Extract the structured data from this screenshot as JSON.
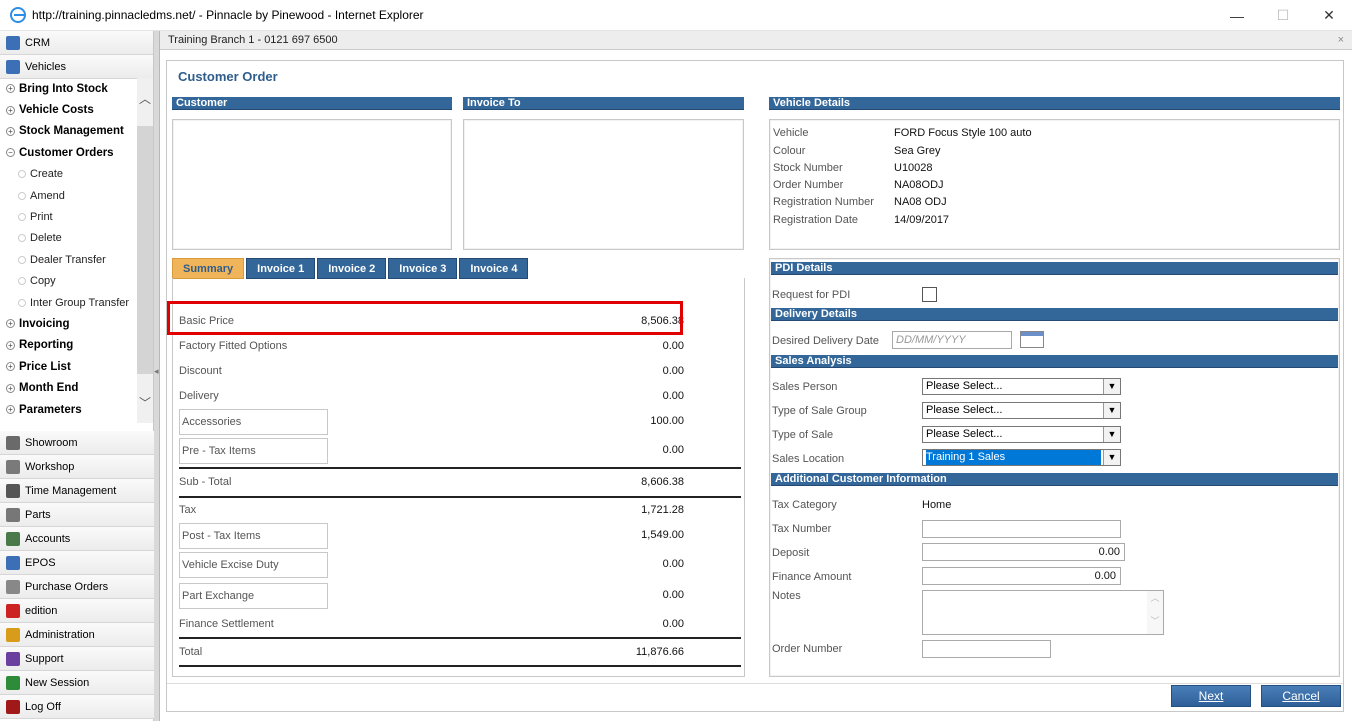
{
  "window": {
    "title": "http://training.pinnacledms.net/ - Pinnacle by Pinewood - Internet Explorer",
    "min": "—",
    "max": "☐",
    "close": "✕"
  },
  "nav": {
    "top": [
      {
        "label": "CRM",
        "icon": "person-icon",
        "color": "#3b6fb6"
      },
      {
        "label": "Vehicles",
        "icon": "car-icon",
        "color": "#3b6fb6"
      }
    ],
    "tree": [
      {
        "label": "Bring Into Stock",
        "type": "group",
        "sign": "+"
      },
      {
        "label": "Vehicle Costs",
        "type": "group",
        "sign": "+"
      },
      {
        "label": "Stock Management",
        "type": "group",
        "sign": "+"
      },
      {
        "label": "Customer Orders",
        "type": "group",
        "sign": "−"
      },
      {
        "label": "Create",
        "type": "sub"
      },
      {
        "label": "Amend",
        "type": "sub"
      },
      {
        "label": "Print",
        "type": "sub"
      },
      {
        "label": "Delete",
        "type": "sub"
      },
      {
        "label": "Dealer Transfer",
        "type": "sub"
      },
      {
        "label": "Copy",
        "type": "sub"
      },
      {
        "label": "Inter Group Transfer",
        "type": "sub"
      },
      {
        "label": "Invoicing",
        "type": "group",
        "sign": "+"
      },
      {
        "label": "Reporting",
        "type": "group",
        "sign": "+"
      },
      {
        "label": "Price List",
        "type": "group",
        "sign": "+"
      },
      {
        "label": "Month End",
        "type": "group",
        "sign": "+"
      },
      {
        "label": "Parameters",
        "type": "group",
        "sign": "+"
      }
    ],
    "bottom": [
      {
        "label": "Showroom",
        "icon": "showroom-icon",
        "color": "#6a6a6a"
      },
      {
        "label": "Workshop",
        "icon": "wrench-icon",
        "color": "#7a7a7a"
      },
      {
        "label": "Time Management",
        "icon": "clock-icon",
        "color": "#555555"
      },
      {
        "label": "Parts",
        "icon": "gear-icon",
        "color": "#777777"
      },
      {
        "label": "Accounts",
        "icon": "accounts-icon",
        "color": "#4a7a4a"
      },
      {
        "label": "EPOS",
        "icon": "epos-icon",
        "color": "#3b6fb6"
      },
      {
        "label": "Purchase Orders",
        "icon": "document-icon",
        "color": "#888888"
      },
      {
        "label": "edition",
        "icon": "edition-icon",
        "color": "#cc2222"
      },
      {
        "label": "Administration",
        "icon": "lock-icon",
        "color": "#d89b1a"
      },
      {
        "label": "Support",
        "icon": "support-icon",
        "color": "#6a3fa0"
      },
      {
        "label": "New Session",
        "icon": "refresh-icon",
        "color": "#2e8b3a"
      },
      {
        "label": "Log Off",
        "icon": "power-icon",
        "color": "#a01818"
      }
    ]
  },
  "branch": "Training Branch 1 - 0121 697 6500",
  "page_title": "Customer Order",
  "sections": {
    "customer": "Customer",
    "invoice_to": "Invoice To",
    "vehicle_details": "Vehicle Details",
    "pdi_details": "PDI Details",
    "delivery_details": "Delivery Details",
    "sales_analysis": "Sales Analysis",
    "additional_info": "Additional Customer Information"
  },
  "tabs": [
    "Summary",
    "Invoice 1",
    "Invoice 2",
    "Invoice 3",
    "Invoice 4"
  ],
  "summary": {
    "basic_price": {
      "label": "Basic Price",
      "value": "8,506.38"
    },
    "factory_options": {
      "label": "Factory Fitted Options",
      "value": "0.00"
    },
    "discount": {
      "label": "Discount",
      "value": "0.00"
    },
    "delivery": {
      "label": "Delivery",
      "value": "0.00"
    },
    "accessories": {
      "label": "Accessories",
      "value": "100.00"
    },
    "pre_tax": {
      "label": "Pre - Tax Items",
      "value": "0.00"
    },
    "sub_total": {
      "label": "Sub - Total",
      "value": "8,606.38"
    },
    "tax": {
      "label": "Tax",
      "value": "1,721.28"
    },
    "post_tax": {
      "label": "Post - Tax Items",
      "value": "1,549.00"
    },
    "excise": {
      "label": "Vehicle Excise Duty",
      "value": "0.00"
    },
    "part_exchange": {
      "label": "Part Exchange",
      "value": "0.00"
    },
    "finance_settlement": {
      "label": "Finance Settlement",
      "value": "0.00"
    },
    "total": {
      "label": "Total",
      "value": "11,876.66"
    }
  },
  "vehicle": {
    "vehicle": {
      "label": "Vehicle",
      "value": "FORD Focus Style 100 auto"
    },
    "colour": {
      "label": "Colour",
      "value": "Sea Grey"
    },
    "stock_number": {
      "label": "Stock Number",
      "value": "U10028"
    },
    "order_number": {
      "label": "Order Number",
      "value": "NA08ODJ"
    },
    "registration_number": {
      "label": "Registration Number",
      "value": "NA08 ODJ"
    },
    "registration_date": {
      "label": "Registration Date",
      "value": "14/09/2017"
    }
  },
  "pdi": {
    "label": "Request for PDI"
  },
  "delivery": {
    "label": "Desired Delivery Date",
    "placeholder": "DD/MM/YYYY"
  },
  "sales": {
    "sales_person": {
      "label": "Sales Person",
      "value": "Please Select..."
    },
    "sale_group": {
      "label": "Type of Sale Group",
      "value": "Please Select..."
    },
    "sale_type": {
      "label": "Type of Sale",
      "value": "Please Select..."
    },
    "location": {
      "label": "Sales Location",
      "value": "Training 1 Sales"
    }
  },
  "additional": {
    "tax_category": {
      "label": "Tax Category",
      "value": "Home"
    },
    "tax_number": {
      "label": "Tax Number",
      "value": ""
    },
    "deposit": {
      "label": "Deposit",
      "value": "0.00"
    },
    "finance_amount": {
      "label": "Finance Amount",
      "value": "0.00"
    },
    "notes": {
      "label": "Notes"
    },
    "order_number": {
      "label": "Order Number",
      "value": ""
    }
  },
  "buttons": {
    "next": "Next",
    "cancel": "Cancel"
  }
}
